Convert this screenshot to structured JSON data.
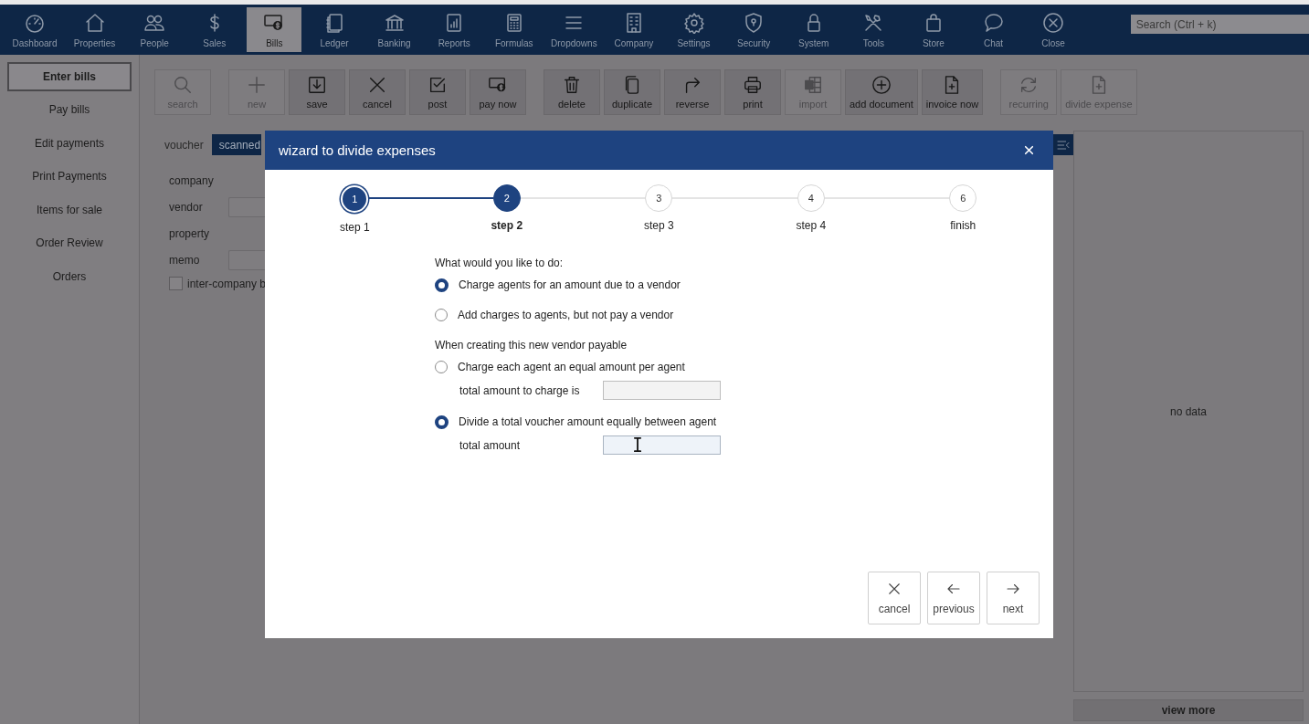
{
  "nav": {
    "items": [
      {
        "label": "Dashboard",
        "selected": false
      },
      {
        "label": "Properties",
        "selected": false
      },
      {
        "label": "People",
        "selected": false
      },
      {
        "label": "Sales",
        "selected": false
      },
      {
        "label": "Bills",
        "selected": true
      },
      {
        "label": "Ledger",
        "selected": false
      },
      {
        "label": "Banking",
        "selected": false
      },
      {
        "label": "Reports",
        "selected": false
      },
      {
        "label": "Formulas",
        "selected": false
      },
      {
        "label": "Dropdowns",
        "selected": false
      },
      {
        "label": "Company",
        "selected": false
      },
      {
        "label": "Settings",
        "selected": false
      },
      {
        "label": "Security",
        "selected": false
      },
      {
        "label": "System",
        "selected": false
      },
      {
        "label": "Tools",
        "selected": false
      },
      {
        "label": "Store",
        "selected": false
      },
      {
        "label": "Chat",
        "selected": false
      },
      {
        "label": "Close",
        "selected": false
      }
    ],
    "search": {
      "placeholder": "Search (Ctrl + k)"
    }
  },
  "sidebar": {
    "items": [
      {
        "label": "Enter bills",
        "selected": true
      },
      {
        "label": "Pay bills",
        "selected": false
      },
      {
        "label": "Edit payments",
        "selected": false
      },
      {
        "label": "Print Payments",
        "selected": false
      },
      {
        "label": "Items for sale",
        "selected": false
      },
      {
        "label": "Order Review",
        "selected": false
      },
      {
        "label": "Orders",
        "selected": false
      }
    ]
  },
  "toolbar": {
    "groups": [
      {
        "buttons": [
          {
            "label": "search",
            "disabled": true
          }
        ]
      },
      {
        "buttons": [
          {
            "label": "new",
            "disabled": true
          },
          {
            "label": "save",
            "disabled": false
          },
          {
            "label": "cancel",
            "disabled": false
          },
          {
            "label": "post",
            "disabled": false
          },
          {
            "label": "pay now",
            "disabled": false
          }
        ]
      },
      {
        "buttons": [
          {
            "label": "delete",
            "disabled": false
          },
          {
            "label": "duplicate",
            "disabled": false
          },
          {
            "label": "reverse",
            "disabled": false
          },
          {
            "label": "print",
            "disabled": false
          },
          {
            "label": "import",
            "disabled": true
          },
          {
            "label": "add document",
            "disabled": false
          },
          {
            "label": "invoice now",
            "disabled": false
          }
        ]
      },
      {
        "buttons": [
          {
            "label": "recurring",
            "disabled": true
          },
          {
            "label": "divide expense",
            "disabled": true
          }
        ]
      }
    ]
  },
  "form": {
    "tabs": [
      {
        "label": "voucher",
        "selected": false
      },
      {
        "label": "scanned",
        "selected": true
      }
    ],
    "fields": [
      {
        "label": "company",
        "kind": "plain"
      },
      {
        "label": "vendor",
        "kind": "input"
      },
      {
        "label": "property",
        "kind": "plain"
      },
      {
        "label": "memo",
        "kind": "input"
      }
    ],
    "checkbox": {
      "label": "inter-company b",
      "checked": false
    }
  },
  "panel": {
    "empty_text": "no data",
    "button": "view more"
  },
  "dialog": {
    "title": "wizard to divide expenses",
    "steps": [
      {
        "number": "1",
        "label": "step 1",
        "completed": true,
        "selected": false
      },
      {
        "number": "2",
        "label": "step 2",
        "completed": false,
        "selected": true
      },
      {
        "number": "3",
        "label": "step 3",
        "completed": false,
        "selected": false
      },
      {
        "number": "4",
        "label": "step 4",
        "completed": false,
        "selected": false
      },
      {
        "number": "6",
        "label": "finish",
        "completed": false,
        "selected": false
      }
    ],
    "sections": [
      {
        "heading": "What would you like to do:",
        "options": [
          {
            "label": "Charge agents for an amount due to a vendor",
            "selected": true
          },
          {
            "label": "Add charges to agents, but not pay a vendor",
            "selected": false
          }
        ]
      },
      {
        "heading": "When creating this new vendor payable",
        "options": [
          {
            "label": "Charge each agent an equal amount per agent",
            "selected": false,
            "field": {
              "label": "total amount to charge is",
              "focused": false
            }
          },
          {
            "label": "Divide a total voucher amount equally between agent",
            "selected": true,
            "field": {
              "label": "total amount",
              "focused": true
            }
          }
        ]
      }
    ],
    "buttons": [
      "cancel",
      "previous",
      "next"
    ]
  }
}
